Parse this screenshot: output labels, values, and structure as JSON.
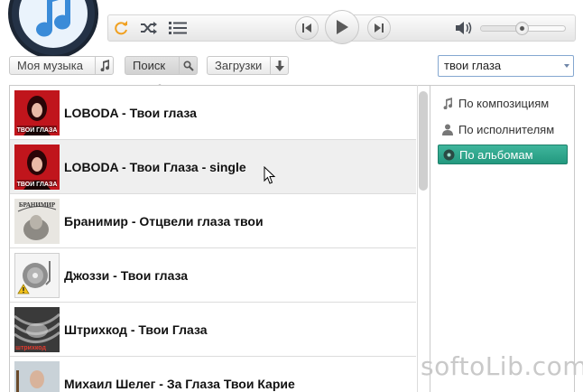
{
  "app": {
    "colors": {
      "accent": "#2aa38a",
      "icon_blue": "#3a8bd8",
      "refresh_orange": "#f0a020"
    }
  },
  "player": {
    "buttons": [
      "refresh-icon",
      "shuffle-icon",
      "playlist-icon",
      "prev-icon",
      "play-icon",
      "next-icon",
      "volume-icon"
    ],
    "volume_level": 0.48
  },
  "nav": {
    "my_music": "Моя музыка",
    "search": "Поиск",
    "downloads": "Загрузки"
  },
  "search": {
    "query": "твои глаза"
  },
  "results": [
    {
      "title": "LOBODA - Твои глаза",
      "cover_text": "ТВОИ ГЛАЗА"
    },
    {
      "title": "LOBODA - Твои Глаза - single",
      "cover_text": "ТВОИ ГЛАЗА"
    },
    {
      "title": "Бранимир - Отцвели глаза твои",
      "cover_text": "БРАНИМИР"
    },
    {
      "title": "Джоззи - Твои глаза",
      "cover_text": ""
    },
    {
      "title": "Штрихкод - Твои Глаза",
      "cover_text": "штрихкод"
    },
    {
      "title": "Михаил Шелег - За Глаза Твои Карие",
      "cover_text": ""
    }
  ],
  "filters": {
    "by_tracks": "По композициям",
    "by_artists": "По исполнителям",
    "by_albums": "По альбомам",
    "selected": "by_albums"
  },
  "watermark": "softoLib.com"
}
